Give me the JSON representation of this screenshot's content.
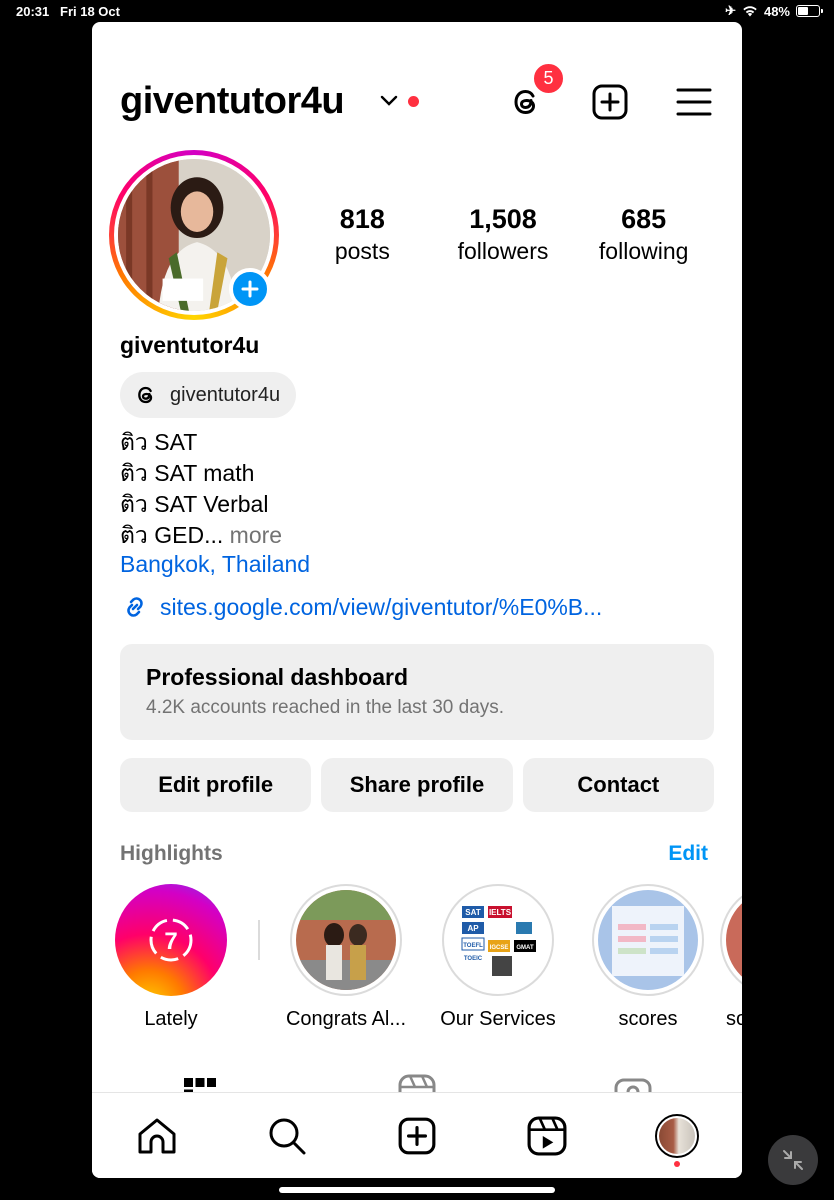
{
  "status_bar": {
    "time": "20:31",
    "date": "Fri 18 Oct",
    "battery": "48%",
    "battery_level": 0.48
  },
  "header": {
    "username": "giventutor4u",
    "threads_badge_count": "5"
  },
  "stats": [
    {
      "value": "818",
      "label": "posts"
    },
    {
      "value": "1,508",
      "label": "followers"
    },
    {
      "value": "685",
      "label": "following"
    }
  ],
  "profile": {
    "name": "giventutor4u",
    "threads_handle": "giventutor4u",
    "bio_lines": [
      "ติว SAT",
      "ติว SAT math",
      "ติว SAT Verbal",
      "ติว GED..."
    ],
    "bio_more": "more",
    "location": "Bangkok, Thailand",
    "link": "sites.google.com/view/giventutor/%E0%B..."
  },
  "dashboard": {
    "title": "Professional dashboard",
    "subtitle": "4.2K accounts reached in the last 30 days."
  },
  "actions": {
    "edit": "Edit profile",
    "share": "Share profile",
    "contact": "Contact"
  },
  "highlights": {
    "title": "Highlights",
    "edit": "Edit",
    "items": [
      {
        "label": "Lately",
        "badge": "7"
      },
      {
        "label": "Congrats Al..."
      },
      {
        "label": "Our Services",
        "tags": [
          "SAT",
          "IELTS",
          "AP",
          "TOEFL",
          "IGCSE",
          "GMAT",
          "TOEIC"
        ]
      },
      {
        "label": "scores"
      },
      {
        "label": "soc"
      }
    ]
  },
  "colors": {
    "accent_blue": "#0095f6",
    "link_blue": "#0064e0",
    "notify_red": "#ff3040"
  }
}
